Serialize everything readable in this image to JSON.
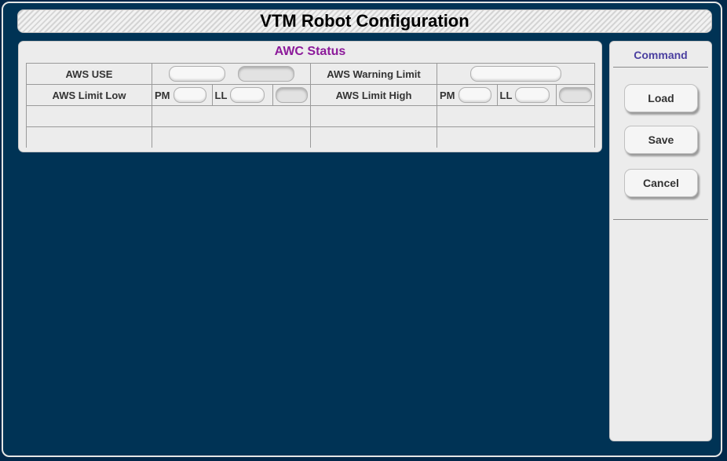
{
  "title": "VTM Robot Configuration",
  "status_panel": {
    "title": "AWC Status",
    "row1": {
      "left_label": "AWS USE",
      "right_label": "AWS Warning Limit"
    },
    "row2": {
      "left_label": "AWS Limit Low",
      "right_label": "AWS Limit High",
      "pm_label": "PM",
      "ll_label": "LL"
    }
  },
  "command_panel": {
    "title": "Command",
    "buttons": {
      "load": "Load",
      "save": "Save",
      "cancel": "Cancel"
    }
  },
  "colors": {
    "background": "#003355",
    "status_title": "#8c1a9a",
    "command_title": "#4a3fa0"
  }
}
